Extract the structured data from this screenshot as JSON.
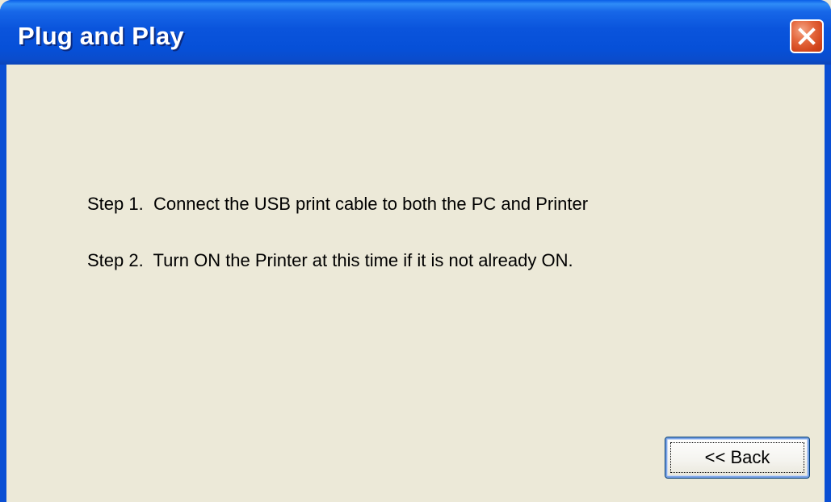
{
  "window": {
    "title": "Plug and Play",
    "close_icon": "close-icon"
  },
  "content": {
    "steps": [
      {
        "text": "Step 1.  Connect the USB print cable to both the PC and Printer"
      },
      {
        "text": "Step 2.  Turn ON the Printer at this time if it is not already ON."
      }
    ]
  },
  "buttons": {
    "back_label": "<< Back"
  },
  "colors": {
    "titlebar": "#0a54dc",
    "client_bg": "#ece9d8",
    "close_button": "#d2451c"
  }
}
